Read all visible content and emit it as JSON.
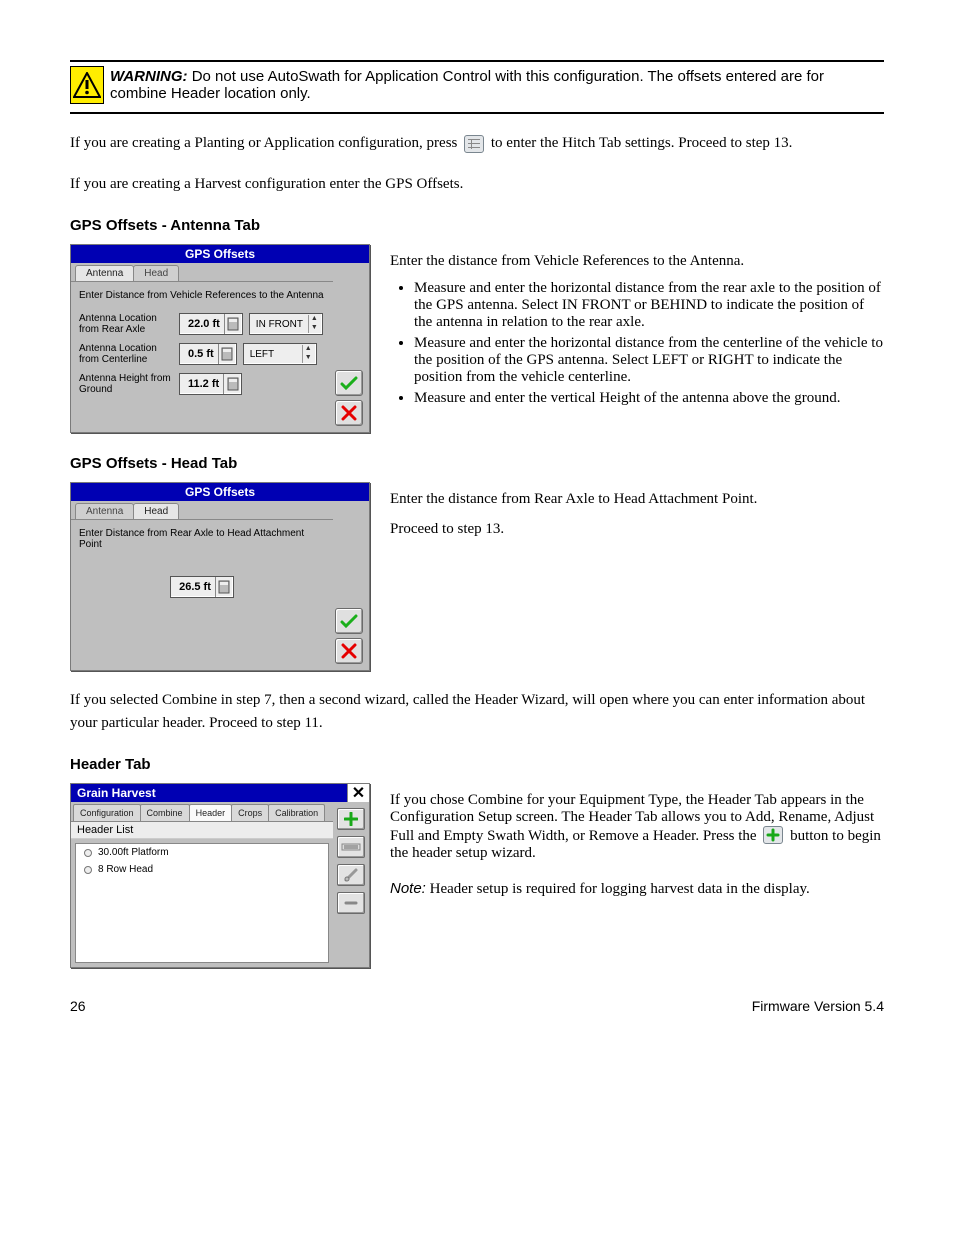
{
  "warning": {
    "prefix": "WARNING:",
    "text": "Do not use AutoSwath for Application Control with this configuration. The offsets entered are for combine Header location only."
  },
  "para1": {
    "before": "If you are creating a Planting or Application configuration, press ",
    "after": " to enter the Hitch Tab settings. Proceed to step 13."
  },
  "para2": "If you are creating a Harvest configuration enter the GPS Offsets.",
  "gps_antenna": {
    "heading": "GPS Offsets - Antenna Tab",
    "sub": "Enter the distance from Vehicle References to the Antenna.",
    "bullets": [
      "Measure and enter the horizontal distance from the rear axle to the position of the GPS antenna.  Select IN FRONT or BEHIND to indicate the position of the antenna in relation to the rear axle.",
      "Measure and enter the horizontal distance from the centerline of the vehicle to the position of the GPS antenna.  Select LEFT or RIGHT to indicate the position from the vehicle centerline.",
      "Measure and enter the vertical Height of the antenna above the ground."
    ],
    "dialog": {
      "title": "GPS Offsets",
      "tabs": [
        "Antenna",
        "Head"
      ],
      "active_tab": 0,
      "instruction": "Enter Distance from Vehicle References to the Antenna",
      "rows": [
        {
          "label": "Antenna Location from Rear Axle",
          "value": "22.0 ft",
          "select": "IN FRONT"
        },
        {
          "label": "Antenna Location from Centerline",
          "value": "0.5 ft",
          "select": "LEFT"
        },
        {
          "label": "Antenna Height from Ground",
          "value": "11.2 ft",
          "select": null
        }
      ]
    }
  },
  "gps_head": {
    "heading": "GPS Offsets - Head Tab",
    "sub": "Enter the distance from Rear Axle to Head Attachment Point.",
    "dialog": {
      "title": "GPS Offsets",
      "tabs": [
        "Antenna",
        "Head"
      ],
      "active_tab": 1,
      "instruction": "Enter Distance from Rear Axle to Head Attachment Point",
      "value": "26.5 ft"
    },
    "proceed": "Proceed to step 13."
  },
  "combine_note": "If you selected Combine in step 7, then a second wizard, called the Header Wizard, will open where you can enter information about your particular header. Proceed to step 11.",
  "header_tab": {
    "heading": "Header Tab",
    "intro_before": "If you chose Combine for your Equipment Type, the Header Tab appears in the Configuration Setup screen. The Header Tab allows you to Add, Rename, Adjust Full and Empty Swath Width, or Remove a Header.  Press the ",
    "intro_after": " button to begin the header setup wizard.",
    "note_label": "Note:",
    "note_text": "Header setup is required for logging harvest data in the display.",
    "dialog": {
      "title": "Grain Harvest",
      "tabs": [
        "Configuration",
        "Combine",
        "Header",
        "Crops",
        "Calibration"
      ],
      "active_tab": 2,
      "list_title": "Header List",
      "items": [
        "30.00ft Platform",
        "8 Row Head"
      ]
    }
  },
  "footer": {
    "page": "26",
    "rev": "Firmware Version 5.4"
  }
}
